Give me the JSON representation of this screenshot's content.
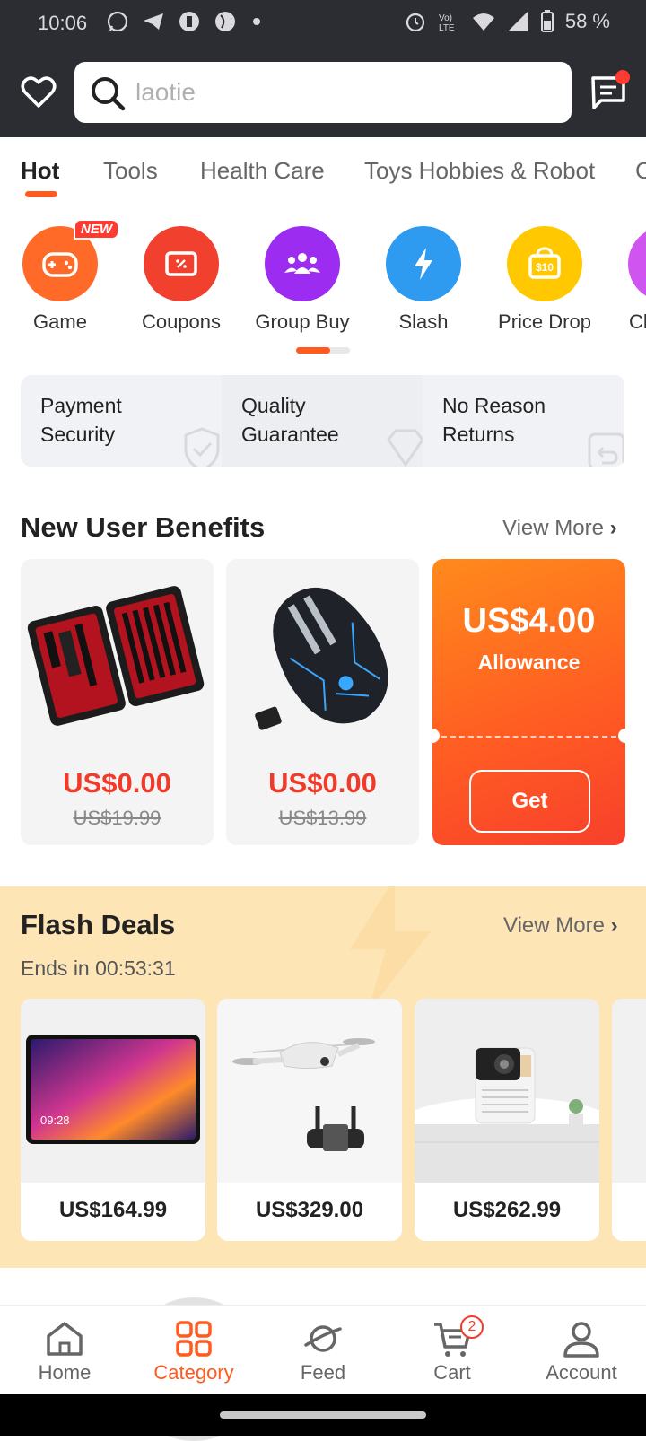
{
  "status_bar": {
    "time": "10:06",
    "battery": "58 %"
  },
  "search": {
    "placeholder": "laotie"
  },
  "tabs": [
    "Hot",
    "Tools",
    "Health Care",
    "Toys Hobbies & Robot",
    "C"
  ],
  "categories": [
    {
      "label": "Game",
      "color": "#ff6a28",
      "icon": "gamepad-icon",
      "badge": "NEW"
    },
    {
      "label": "Coupons",
      "color": "#f2402e",
      "icon": "coupon-icon"
    },
    {
      "label": "Group Buy",
      "color": "#9b2cf0",
      "icon": "group-icon"
    },
    {
      "label": "Slash",
      "color": "#2e9bf0",
      "icon": "lightning-icon"
    },
    {
      "label": "Price Drop",
      "color": "#ffc800",
      "icon": "price-tag-icon",
      "icon_text": "$10"
    },
    {
      "label": "Cle",
      "color": "#d054f0",
      "icon": "clearance-icon"
    }
  ],
  "guarantees": [
    {
      "line1": "Payment",
      "line2": "Security",
      "icon": "shield-check-icon"
    },
    {
      "line1": "Quality",
      "line2": "Guarantee",
      "icon": "diamond-icon"
    },
    {
      "line1": "No Reason",
      "line2": "Returns",
      "icon": "return-box-icon"
    }
  ],
  "new_user": {
    "title": "New User Benefits",
    "view_more": "View More",
    "products": [
      {
        "name": "manicure-kit",
        "price": "US$0.00",
        "original": "US$19.99"
      },
      {
        "name": "gaming-mouse",
        "price": "US$0.00",
        "original": "US$13.99"
      }
    ],
    "allowance": {
      "amount": "US$4.00",
      "label": "Allowance",
      "button": "Get"
    }
  },
  "flash": {
    "title": "Flash Deals",
    "ends": "Ends in 00:53:31",
    "view_more": "View More",
    "tablet_time": "09:28",
    "products": [
      {
        "name": "tablet",
        "price": "US$164.99"
      },
      {
        "name": "drone",
        "price": "US$329.00"
      },
      {
        "name": "projector",
        "price": "US$262.99"
      }
    ]
  },
  "nav": [
    {
      "label": "Home",
      "icon": "home-icon"
    },
    {
      "label": "Category",
      "icon": "category-grid-icon",
      "active": true
    },
    {
      "label": "Feed",
      "icon": "planet-icon"
    },
    {
      "label": "Cart",
      "icon": "cart-icon",
      "badge": "2"
    },
    {
      "label": "Account",
      "icon": "person-icon"
    }
  ],
  "colors": {
    "accent": "#ff5a1f",
    "price_red": "#f03b2a",
    "header_bg": "#2b2d33",
    "flash_bg": "#fde5b6"
  }
}
